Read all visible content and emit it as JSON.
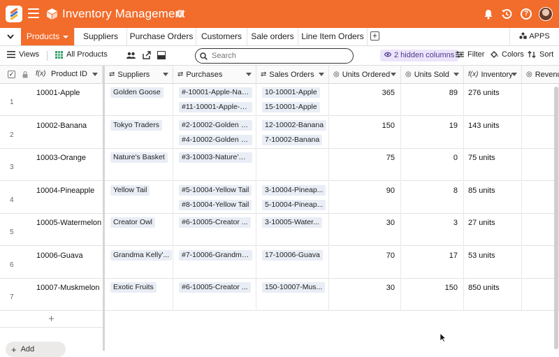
{
  "app": {
    "title": "Inventory Management",
    "accent_color": "#f26c2b",
    "logo_icon": "stackby-logo-icon",
    "menu_icon": "hamburger-icon",
    "base_icon": "cube-icon",
    "top_icons": [
      "bell-icon",
      "history-icon",
      "help-icon",
      "avatar"
    ]
  },
  "tabs": {
    "items": [
      {
        "label": "Products"
      },
      {
        "label": "Suppliers"
      },
      {
        "label": "Purchase Orders"
      },
      {
        "label": "Customers"
      },
      {
        "label": "Sale orders"
      },
      {
        "label": "Line Item Orders"
      }
    ],
    "add_label": "+",
    "apps_label": "APPS"
  },
  "toolbar": {
    "views_label": "Views",
    "view_name": "All Products",
    "search_placeholder": "Search",
    "hidden_columns": "2 hidden columns",
    "filter_label": "Filter",
    "colors_label": "Colors",
    "sort_label": "Sort"
  },
  "columns": {
    "product_id": "Product ID",
    "suppliers": "Suppliers",
    "purchases": "Purchases",
    "sales_orders": "Sales Orders",
    "units_ordered": "Units Ordered",
    "units_sold": "Units Sold",
    "inventory": "Inventory",
    "revenue": "Revenu"
  },
  "rows": [
    {
      "num": "1",
      "product_id": "10001-Apple",
      "supplier": "Golden Goose",
      "purchases": [
        "#-10001-Apple-Nat...",
        "#11-10001-Apple-N..."
      ],
      "sales": [
        "10-10001-Apple",
        "15-10001-Apple"
      ],
      "units_ordered": "365",
      "units_sold": "89",
      "inventory": "276 units"
    },
    {
      "num": "2",
      "product_id": "10002-Banana",
      "supplier": "Tokyo Traders",
      "purchases": [
        "#2-10002-Golden G...",
        "#4-10002-Golden G..."
      ],
      "sales": [
        "12-10002-Banana",
        "7-10002-Banana"
      ],
      "units_ordered": "150",
      "units_sold": "19",
      "inventory": "143 units"
    },
    {
      "num": "3",
      "product_id": "10003-Orange",
      "supplier": "Nature's Basket",
      "purchases": [
        "#3-10003-Nature's ..."
      ],
      "sales": [],
      "units_ordered": "75",
      "units_sold": "0",
      "inventory": "75 units"
    },
    {
      "num": "4",
      "product_id": "10004-Pineapple",
      "supplier": "Yellow Tail",
      "purchases": [
        "#5-10004-Yellow Tail",
        "#8-10004-Yellow Tail"
      ],
      "sales": [
        "3-10004-Pineap...",
        "5-10004-Pineap..."
      ],
      "units_ordered": "90",
      "units_sold": "8",
      "inventory": "85 units"
    },
    {
      "num": "5",
      "product_id": "10005-Watermelon",
      "supplier": "Creator Owl",
      "purchases": [
        "#6-10005-Creator ..."
      ],
      "sales": [
        "3-10005-Water..."
      ],
      "units_ordered": "30",
      "units_sold": "3",
      "inventory": "27 units"
    },
    {
      "num": "6",
      "product_id": "10006-Guava",
      "supplier": "Grandma Kelly'...",
      "purchases": [
        "#7-10006-Grandma..."
      ],
      "sales": [
        "17-10006-Guava"
      ],
      "units_ordered": "70",
      "units_sold": "17",
      "inventory": "53 units"
    },
    {
      "num": "7",
      "product_id": "10007-Muskmelon",
      "supplier": "Exotic Fruits",
      "purchases": [
        "#6-10005-Creator ..."
      ],
      "sales": [
        "150-10007-Mus..."
      ],
      "units_ordered": "30",
      "units_sold": "150",
      "inventory": "850 units"
    }
  ],
  "footer": {
    "add_row_label": "+",
    "add_label": "Add",
    "plus_label": "+"
  }
}
